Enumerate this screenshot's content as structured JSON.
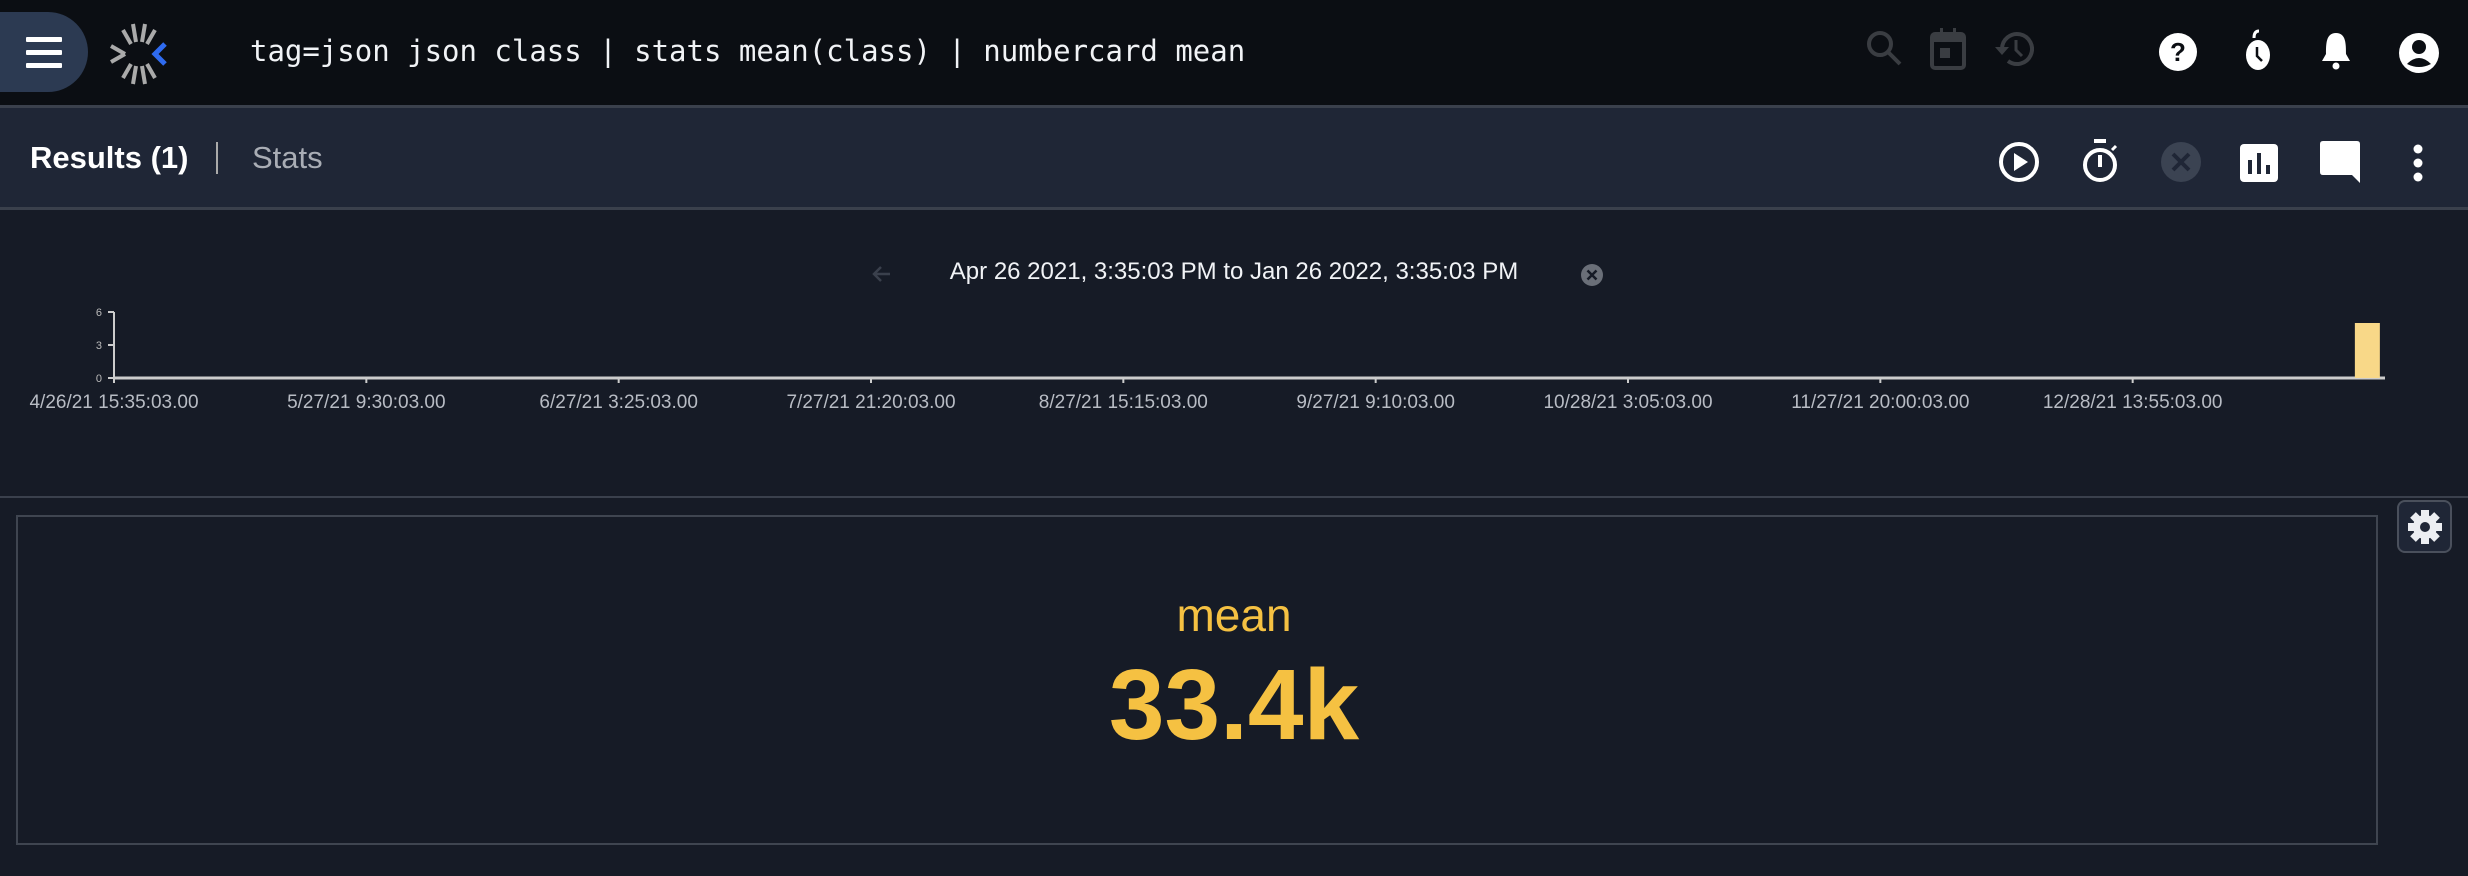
{
  "header": {
    "query": "tag=json json class | stats mean(class) | numbercard mean",
    "icons": [
      "menu-icon",
      "logo-icon",
      "search-icon",
      "calendar-icon",
      "history-icon",
      "help-icon",
      "timer-icon",
      "bell-icon",
      "account-icon"
    ]
  },
  "toolbar": {
    "tabs": [
      {
        "label": "Results (1)",
        "active": true
      },
      {
        "label": "Stats",
        "active": false
      }
    ],
    "icons": [
      "play-icon",
      "stopwatch-icon",
      "cancel-icon",
      "chart-icon",
      "comment-icon",
      "more-vert-icon"
    ]
  },
  "timeline": {
    "range_text": "Apr 26 2021, 3:35:03 PM to Jan 26 2022, 3:35:03 PM"
  },
  "chart_data": {
    "type": "bar",
    "x_tick_labels": [
      "4/26/21 15:35:03.00",
      "5/27/21 9:30:03.00",
      "6/27/21 3:25:03.00",
      "7/27/21 21:20:03.00",
      "8/27/21 15:15:03.00",
      "9/27/21 9:10:03.00",
      "10/28/21 3:05:03.00",
      "11/27/21 20:00:03.00",
      "12/28/21 13:55:03.00"
    ],
    "y_tick_labels": [
      "0",
      "3",
      "6"
    ],
    "xlim": [
      "4/26/21 15:35:03",
      "1/26/22 15:35:03"
    ],
    "ylim": [
      0,
      6
    ],
    "bars": [
      {
        "x": "1/23/22",
        "value": 5
      }
    ],
    "bar_color": "#f8d888"
  },
  "card": {
    "label": "mean",
    "value": "33.4k",
    "color": "#f5c142"
  }
}
